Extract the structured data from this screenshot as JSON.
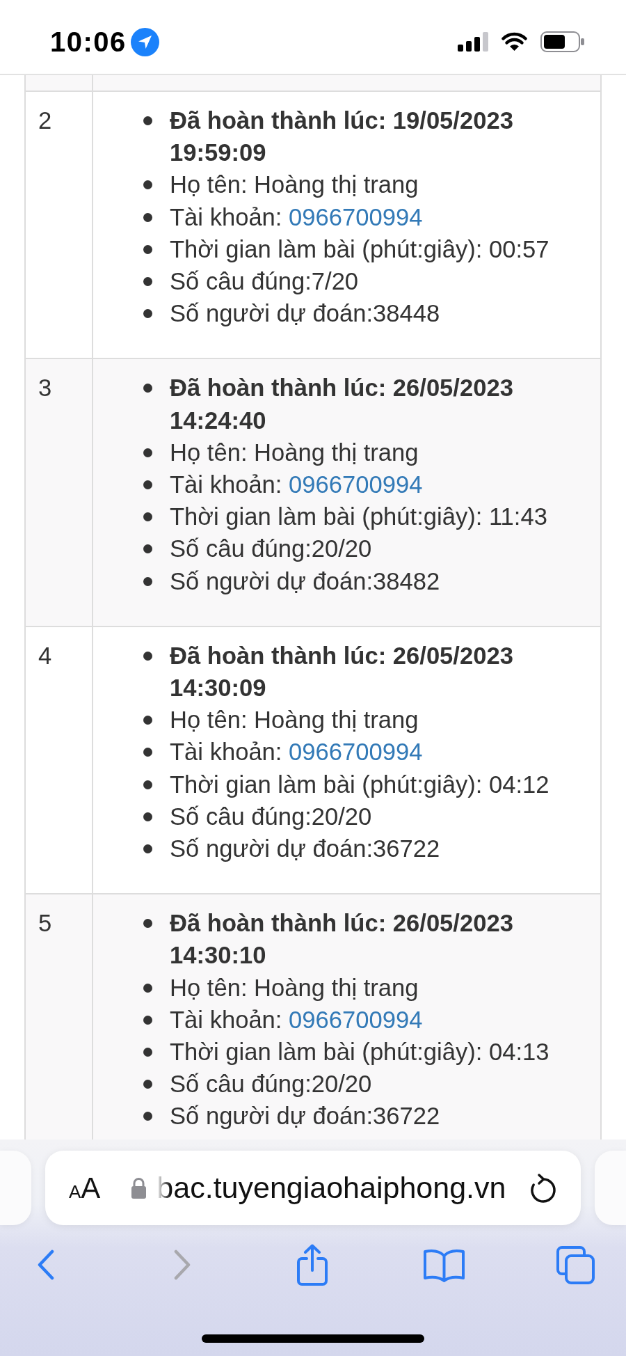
{
  "status_bar": {
    "time": "10:06"
  },
  "table": {
    "rows": [
      {
        "number": "2",
        "completed_at": "Đã hoàn thành lúc: 19/05/2023 19:59:09",
        "full_name": "Họ tên: Hoàng thị trang",
        "account_label": "Tài khoản:",
        "account": "0966700994",
        "duration": "Thời gian làm bài (phút:giây): 00:57",
        "correct_answers": "Số câu đúng:7/20",
        "predicted_count": "Số người dự đoán:38448"
      },
      {
        "number": "3",
        "completed_at": "Đã hoàn thành lúc: 26/05/2023 14:24:40",
        "full_name": "Họ tên: Hoàng thị trang",
        "account_label": "Tài khoản:",
        "account": "0966700994",
        "duration": "Thời gian làm bài (phút:giây): 11:43",
        "correct_answers": "Số câu đúng:20/20",
        "predicted_count": "Số người dự đoán:38482"
      },
      {
        "number": "4",
        "completed_at": "Đã hoàn thành lúc: 26/05/2023 14:30:09",
        "full_name": "Họ tên: Hoàng thị trang",
        "account_label": "Tài khoản:",
        "account": "0966700994",
        "duration": "Thời gian làm bài (phút:giây): 04:12",
        "correct_answers": "Số câu đúng:20/20",
        "predicted_count": "Số người dự đoán:36722"
      },
      {
        "number": "5",
        "completed_at": "Đã hoàn thành lúc: 26/05/2023 14:30:10",
        "full_name": "Họ tên: Hoàng thị trang",
        "account_label": "Tài khoản:",
        "account": "0966700994",
        "duration": "Thời gian làm bài (phút:giây): 04:13",
        "correct_answers": "Số câu đúng:20/20",
        "predicted_count": "Số người dự đoán:36722"
      }
    ]
  },
  "browser": {
    "text_size_button": "AA",
    "url": "bac.tuyengiaohaiphong.vn",
    "toolbar": [
      {
        "kind": "back",
        "disabled": false
      },
      {
        "kind": "forward",
        "disabled": true
      },
      {
        "kind": "share",
        "disabled": false
      },
      {
        "kind": "bookmarks",
        "disabled": false
      },
      {
        "kind": "tabs",
        "disabled": false
      }
    ]
  }
}
